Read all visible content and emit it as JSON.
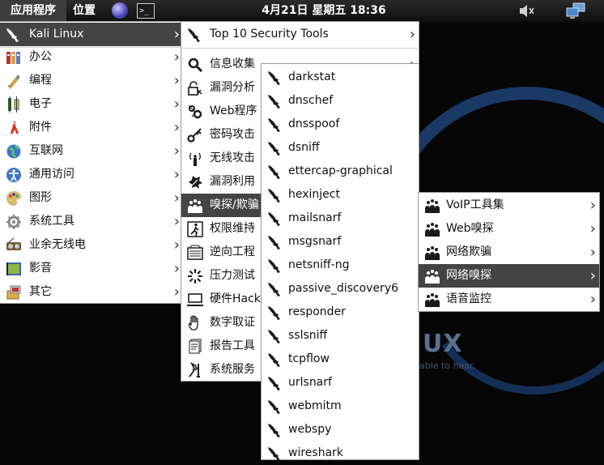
{
  "panel": {
    "apps": "应用程序",
    "places": "位置",
    "terminal_glyph": ">_",
    "clock": "4月21日 星期五 18:36",
    "icons": [
      "browser-globe-icon",
      "terminal-icon",
      "volume-muted-icon",
      "network-icon"
    ]
  },
  "menu_main": {
    "items": [
      {
        "label": "Kali Linux",
        "icon": "kali-dragon-icon",
        "active": true
      },
      {
        "label": "办公",
        "icon": "office-icon"
      },
      {
        "label": "编程",
        "icon": "programming-icon"
      },
      {
        "label": "电子",
        "icon": "electronics-icon"
      },
      {
        "label": "附件",
        "icon": "accessories-icon"
      },
      {
        "label": "互联网",
        "icon": "internet-globe-icon"
      },
      {
        "label": "通用访问",
        "icon": "accessibility-icon"
      },
      {
        "label": "图形",
        "icon": "graphics-icon"
      },
      {
        "label": "系统工具",
        "icon": "system-tools-icon"
      },
      {
        "label": "业余无线电",
        "icon": "ham-radio-icon"
      },
      {
        "label": "影音",
        "icon": "multimedia-icon"
      },
      {
        "label": "其它",
        "icon": "other-icon"
      }
    ]
  },
  "menu_kali": {
    "items": [
      {
        "label": "Top 10 Security Tools",
        "icon": "kali-dragon-icon"
      },
      {
        "label": "信息收集",
        "icon": "magnifier-icon"
      },
      {
        "label": "漏洞分析",
        "icon": "vulnerability-icon"
      },
      {
        "label": "Web程序",
        "icon": "web-gears-icon"
      },
      {
        "label": "密码攻击",
        "icon": "key-icon"
      },
      {
        "label": "无线攻击",
        "icon": "wireless-icon"
      },
      {
        "label": "漏洞利用",
        "icon": "exploit-icon"
      },
      {
        "label": "嗅探/欺骗",
        "icon": "sniffing-icon",
        "active": true
      },
      {
        "label": "权限维持",
        "icon": "persistence-icon"
      },
      {
        "label": "逆向工程",
        "icon": "reverse-engineering-icon"
      },
      {
        "label": "压力测试",
        "icon": "stress-test-icon"
      },
      {
        "label": "硬件Hack",
        "icon": "hardware-hack-icon"
      },
      {
        "label": "数字取证",
        "icon": "forensics-hand-icon"
      },
      {
        "label": "报告工具",
        "icon": "reporting-icon"
      },
      {
        "label": "系统服务",
        "icon": "system-services-icon"
      }
    ]
  },
  "menu_sniff": {
    "items": [
      {
        "label": "VoIP工具集",
        "icon": "sniffing-icon"
      },
      {
        "label": "Web嗅探",
        "icon": "sniffing-icon"
      },
      {
        "label": "网络欺骗",
        "icon": "sniffing-icon"
      },
      {
        "label": "网络嗅探",
        "icon": "sniffing-icon",
        "active": true
      },
      {
        "label": "语音监控",
        "icon": "sniffing-icon"
      }
    ]
  },
  "menu_tools": {
    "items": [
      {
        "label": "darkstat",
        "icon": "kali-dragon-icon"
      },
      {
        "label": "dnschef",
        "icon": "kali-dragon-icon"
      },
      {
        "label": "dnsspoof",
        "icon": "kali-dragon-icon"
      },
      {
        "label": "dsniff",
        "icon": "kali-dragon-icon"
      },
      {
        "label": "ettercap-graphical",
        "icon": "kali-dragon-icon"
      },
      {
        "label": "hexinject",
        "icon": "kali-dragon-icon"
      },
      {
        "label": "mailsnarf",
        "icon": "kali-dragon-icon"
      },
      {
        "label": "msgsnarf",
        "icon": "kali-dragon-icon"
      },
      {
        "label": "netsniff-ng",
        "icon": "kali-dragon-icon"
      },
      {
        "label": "passive_discovery6",
        "icon": "kali-dragon-icon"
      },
      {
        "label": "responder",
        "icon": "kali-dragon-icon"
      },
      {
        "label": "sslsniff",
        "icon": "kali-dragon-icon"
      },
      {
        "label": "tcpflow",
        "icon": "kali-dragon-icon"
      },
      {
        "label": "urlsnarf",
        "icon": "kali-dragon-icon"
      },
      {
        "label": "webmitm",
        "icon": "kali-dragon-icon"
      },
      {
        "label": "webspy",
        "icon": "kali-dragon-icon"
      },
      {
        "label": "wireshark",
        "icon": "kali-dragon-icon"
      }
    ]
  },
  "wallpaper": {
    "logo": "UX",
    "tagline": "able to hear."
  },
  "colors": {
    "panel": "#1c1c1c",
    "menu_bg": "#ffffff",
    "highlight": "#444444",
    "wallpaper_accent": "#1b3966"
  }
}
